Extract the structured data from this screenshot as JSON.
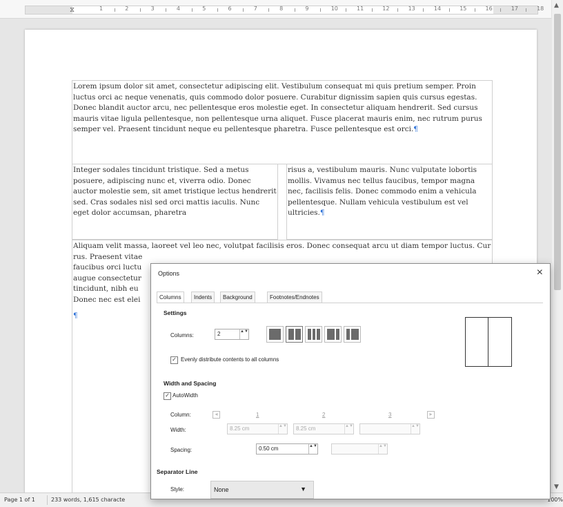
{
  "ruler": {
    "numbers": [
      "1",
      "2",
      "3",
      "4",
      "5",
      "6",
      "7",
      "8",
      "9",
      "10",
      "11",
      "12",
      "13",
      "14",
      "15",
      "16",
      "17",
      "18"
    ]
  },
  "document": {
    "paragraph1": "Lorem ipsum dolor sit amet, consectetur adipiscing elit. Vestibulum consequat mi quis pretium semper. Proin luctus orci ac neque venenatis, quis commodo dolor posuere. Curabitur dignissim sapien quis cursus egestas. Donec blandit auctor arcu, nec pellentesque eros molestie eget. In consectetur aliquam hendrerit. Sed cursus mauris vitae ligula pellentesque, non pellentesque urna aliquet. Fusce placerat mauris enim, nec rutrum purus semper vel. Praesent tincidunt neque eu pellentesque pharetra. Fusce pellentesque est orci.",
    "column1": "Integer sodales tincidunt tristique. Sed a metus posuere, adipiscing nunc et, viverra odio. Donec auctor molestie sem, sit amet tristique lectus hendrerit sed. Cras sodales nisl sed orci mattis iaculis. Nunc eget dolor accumsan, pharetra",
    "column2": "risus a, vestibulum mauris. Nunc vulputate lobortis mollis. Vivamus nec tellus faucibus, tempor magna nec, facilisis felis. Donec commodo enim a vehicula pellentesque. Nullam vehicula vestibulum est vel ultricies.",
    "paragraph3": "Aliquam velit massa, laoreet vel leo nec, volutpat facilisis eros. Donec consequat arcu ut diam tempor luctus. Cur",
    "p3_lines": [
      "rus. Praesent vitae",
      "faucibus orci luctu",
      "augue consectetur",
      "tincidunt, nibh eu",
      "Donec nec est elei"
    ],
    "pilcrow": "¶"
  },
  "statusbar": {
    "page": "Page 1 of 1",
    "words": "233 words, 1,615 characte",
    "zoom": "100%"
  },
  "dialog": {
    "title": "Options",
    "close": "×",
    "tabs": [
      "Columns",
      "Indents",
      "Background",
      "Footnotes/Endnotes"
    ],
    "settings": {
      "heading": "Settings",
      "columns_label": "Columns:",
      "columns_value": "2",
      "spinner": "▲▼",
      "evenly_label": "Evenly distribute contents to all columns",
      "evenly_checked": "✓",
      "presets": [
        1,
        2,
        3,
        "2L",
        "2R"
      ],
      "selected_preset": 2
    },
    "width_spacing": {
      "heading": "Width and Spacing",
      "autowidth_label": "AutoWidth",
      "autowidth_checked": "✓",
      "column_label": "Column:",
      "column_numbers": [
        "1",
        "2",
        "3"
      ],
      "width_label": "Width:",
      "width_values": [
        "8.25 cm",
        "8.25 cm",
        ""
      ],
      "spacing_label": "Spacing:",
      "spacing_values": [
        "0.50 cm",
        ""
      ]
    },
    "separator": {
      "heading": "Separator Line",
      "style_label": "Style:",
      "style_value": "None",
      "caret": "▼"
    }
  }
}
